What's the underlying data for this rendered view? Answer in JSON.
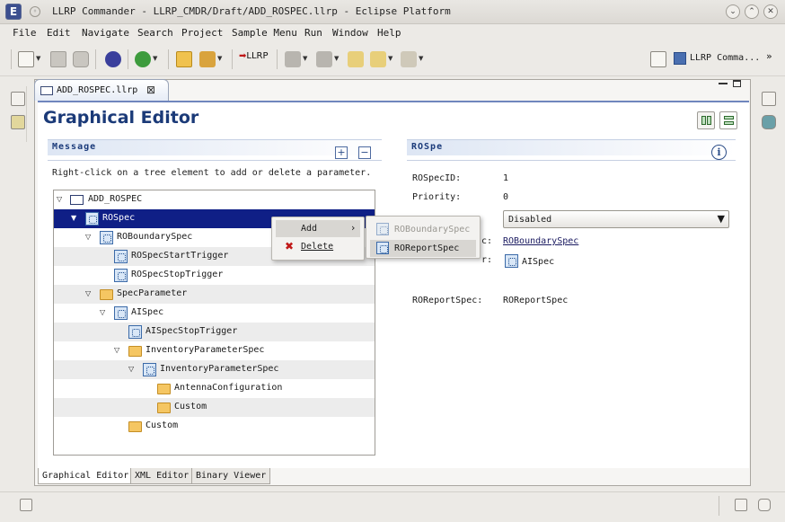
{
  "window": {
    "title": "LLRP Commander - LLRP_CMDR/Draft/ADD_ROSPEC.llrp - Eclipse Platform",
    "app_icon": "E"
  },
  "menu": [
    "File",
    "Edit",
    "Navigate",
    "Search",
    "Project",
    "Sample Menu",
    "Run",
    "Window",
    "Help"
  ],
  "toolbar": {
    "llrp_button": "LLRP",
    "perspective": "LLRP Comma...",
    "overflow": "»"
  },
  "editor": {
    "tab_label": "ADD_ROSPEC.llrp",
    "close_glyph": "⊠",
    "title": "Graphical Editor",
    "message_section": {
      "header": "Message",
      "hint": "Right-click on a tree element to add or delete a parameter.",
      "tree": [
        {
          "label": "ADD_ROSPEC",
          "depth": 0,
          "icon": "message-icon",
          "expanded": true
        },
        {
          "label": "ROSpec",
          "depth": 1,
          "icon": "parameter-icon",
          "expanded": true,
          "selected": true
        },
        {
          "label": "ROBoundarySpec",
          "depth": 2,
          "icon": "parameter-icon",
          "expanded": true
        },
        {
          "label": "ROSpecStartTrigger",
          "depth": 3,
          "icon": "parameter-icon"
        },
        {
          "label": "ROSpecStopTrigger",
          "depth": 3,
          "icon": "parameter-icon"
        },
        {
          "label": "SpecParameter",
          "depth": 2,
          "icon": "folder-icon",
          "expanded": true
        },
        {
          "label": "AISpec",
          "depth": 3,
          "icon": "parameter-icon",
          "expanded": true
        },
        {
          "label": "AISpecStopTrigger",
          "depth": 4,
          "icon": "parameter-icon"
        },
        {
          "label": "InventoryParameterSpec",
          "depth": 4,
          "icon": "folder-icon",
          "expanded": true
        },
        {
          "label": "InventoryParameterSpec",
          "depth": 5,
          "icon": "parameter-icon",
          "expanded": true
        },
        {
          "label": "AntennaConfiguration",
          "depth": 6,
          "icon": "folder-icon"
        },
        {
          "label": "Custom",
          "depth": 6,
          "icon": "folder-icon"
        },
        {
          "label": "Custom",
          "depth": 4,
          "icon": "folder-icon"
        }
      ]
    },
    "rospec_section": {
      "header": "ROSpe",
      "rospec_id_label": "ROSpecID:",
      "rospec_id_value": "1",
      "priority_label": "Priority:",
      "priority_value": "0",
      "state_value": "Disabled",
      "boundary_label_frag": "c:",
      "boundary_value": "ROBoundarySpec",
      "spec_label_frag": "r:",
      "spec_value": "AISpec",
      "report_label": "ROReportSpec:",
      "report_value": "ROReportSpec"
    },
    "context_menu": {
      "add": "Add",
      "delete": "Delete",
      "submenu": [
        "ROBoundarySpec",
        "ROReportSpec"
      ]
    },
    "bottom_tabs": [
      "Graphical Editor",
      "XML Editor",
      "Binary Viewer"
    ]
  }
}
